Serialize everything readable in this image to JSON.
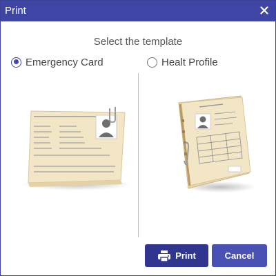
{
  "titlebar": {
    "title": "Print",
    "close_icon": "close-icon"
  },
  "heading": "Select the template",
  "options": [
    {
      "label": "Emergency Card",
      "selected": true
    },
    {
      "label": "Healt Profile",
      "selected": false
    }
  ],
  "buttons": {
    "print_label": "Print",
    "print_icon": "printer-icon",
    "cancel_label": "Cancel"
  },
  "colors": {
    "accent": "#3e45a4",
    "print_button": "#303690",
    "cancel_button": "#4a51b5",
    "card": "#f1e2be"
  }
}
